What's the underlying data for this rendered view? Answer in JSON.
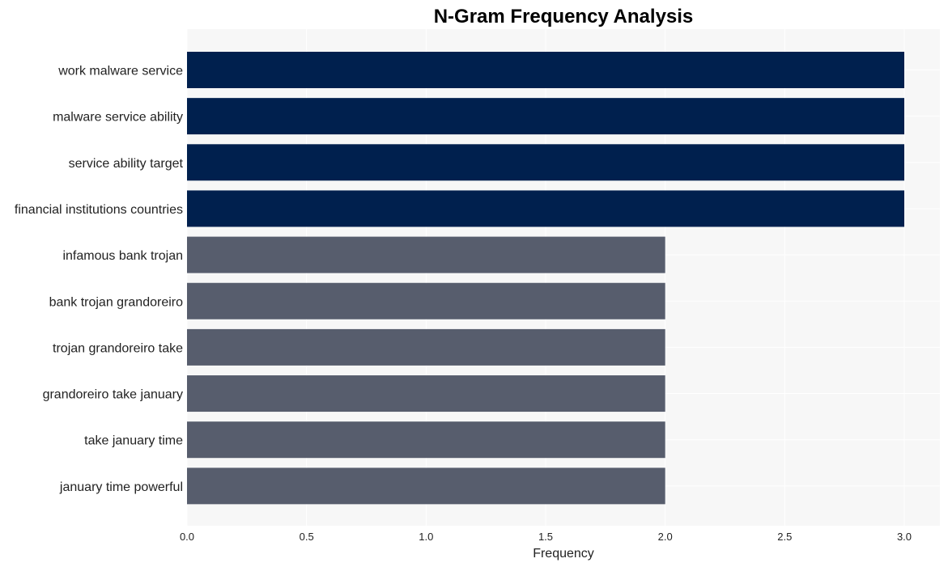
{
  "chart_data": {
    "type": "bar",
    "orientation": "horizontal",
    "title": "N-Gram Frequency Analysis",
    "xlabel": "Frequency",
    "ylabel": "",
    "xlim": [
      0,
      3.15
    ],
    "xticks": [
      0.0,
      0.5,
      1.0,
      1.5,
      2.0,
      2.5,
      3.0
    ],
    "xtick_labels": [
      "0.0",
      "0.5",
      "1.0",
      "1.5",
      "2.0",
      "2.5",
      "3.0"
    ],
    "grid": true,
    "categories": [
      "work malware service",
      "malware service ability",
      "service ability target",
      "financial institutions countries",
      "infamous bank trojan",
      "bank trojan grandoreiro",
      "trojan grandoreiro take",
      "grandoreiro take january",
      "take january time",
      "january time powerful"
    ],
    "values": [
      3,
      3,
      3,
      3,
      2,
      2,
      2,
      2,
      2,
      2
    ],
    "colors": {
      "high": "#00204e",
      "low": "#575d6d",
      "plot_background": "#f7f7f7",
      "grid": "#ffffff"
    }
  }
}
